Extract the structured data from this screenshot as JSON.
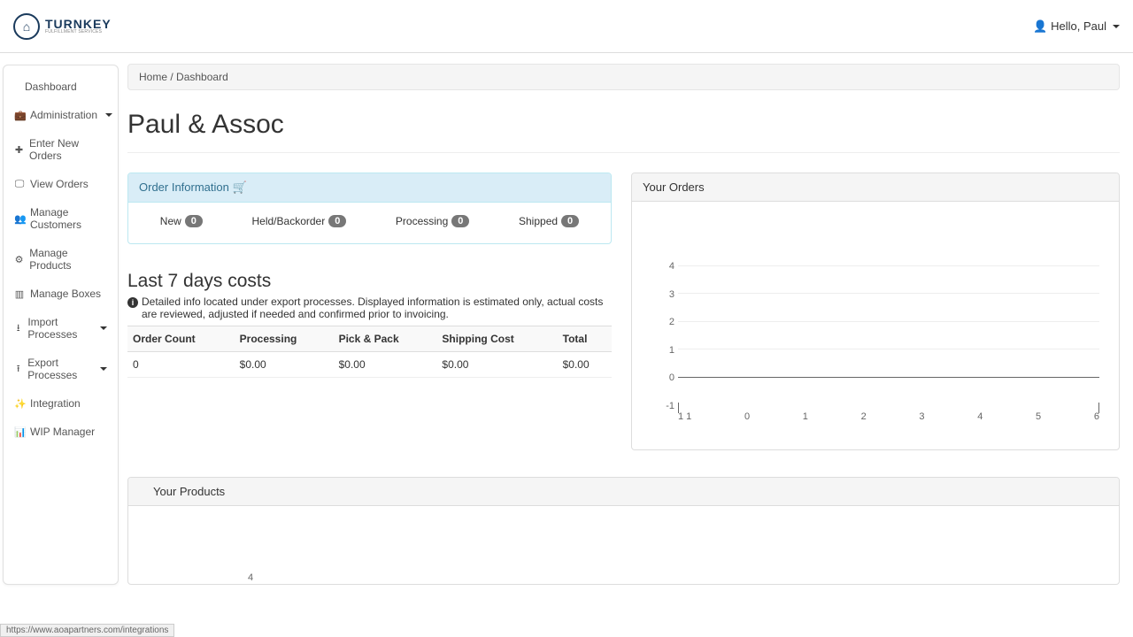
{
  "brand": {
    "name": "TURNKEY",
    "tagline": "FULFILLMENT SERVICES"
  },
  "user": {
    "greeting": "Hello, Paul"
  },
  "sidebar": {
    "items": [
      {
        "label": "Dashboard",
        "icon": ""
      },
      {
        "label": "Administration",
        "icon": "briefcase",
        "caret": true
      },
      {
        "label": "Enter New Orders",
        "icon": "plus"
      },
      {
        "label": "View Orders",
        "icon": "dash"
      },
      {
        "label": "Manage Customers",
        "icon": "users"
      },
      {
        "label": "Manage Products",
        "icon": "gear"
      },
      {
        "label": "Manage Boxes",
        "icon": "box"
      },
      {
        "label": "Import Processes",
        "icon": "download",
        "caret": true
      },
      {
        "label": "Export Processes",
        "icon": "upload",
        "caret": true
      },
      {
        "label": "Integration",
        "icon": "wand"
      },
      {
        "label": "WIP Manager",
        "icon": "bars"
      }
    ]
  },
  "breadcrumb": {
    "home": "Home",
    "sep": "/",
    "current": "Dashboard"
  },
  "page": {
    "title": "Paul & Assoc"
  },
  "order_info": {
    "heading": "Order Information",
    "stats": [
      {
        "label": "New",
        "count": "0"
      },
      {
        "label": "Held/Backorder",
        "count": "0"
      },
      {
        "label": "Processing",
        "count": "0"
      },
      {
        "label": "Shipped",
        "count": "0"
      }
    ]
  },
  "costs": {
    "heading": "Last 7 days costs",
    "note": "Detailed info located under export processes. Displayed information is estimated only, actual costs are reviewed, adjusted if needed and confirmed prior to invoicing.",
    "headers": [
      "Order Count",
      "Processing",
      "Pick & Pack",
      "Shipping Cost",
      "Total"
    ],
    "row": [
      "0",
      "$0.00",
      "$0.00",
      "$0.00",
      "$0.00"
    ]
  },
  "your_orders": {
    "heading": "Your Orders"
  },
  "your_products": {
    "heading": "Your Products"
  },
  "chart_data": {
    "type": "line",
    "title": "Your Orders",
    "x": [
      1,
      2,
      3,
      4,
      5,
      6
    ],
    "values": [
      0,
      0,
      0,
      0,
      0,
      0
    ],
    "y_ticks": [
      "4",
      "3",
      "2",
      "1",
      "0",
      "-1"
    ],
    "x_ticks_display": [
      "1 1",
      "0",
      "1",
      "2",
      "3",
      "4",
      "5",
      "6"
    ],
    "ylim": [
      -1,
      4
    ]
  },
  "products_chart": {
    "y_tick": "4"
  },
  "status_url": "https://www.aoapartners.com/integrations"
}
